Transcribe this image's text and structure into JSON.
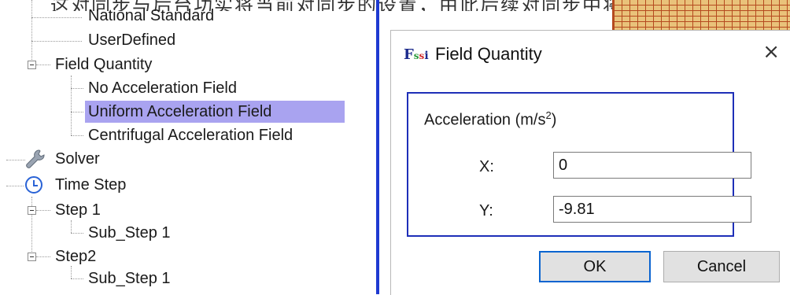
{
  "banner": {
    "text": "这对同步与后台功实将当前对同步的设置，由此后续对同步中将至更施加"
  },
  "tree": {
    "items": [
      {
        "label": "National Standard"
      },
      {
        "label": "UserDefined"
      },
      {
        "label": "Field Quantity"
      },
      {
        "label": "No Acceleration Field"
      },
      {
        "label": "Uniform Acceleration Field"
      },
      {
        "label": "Centrifugal Acceleration Field"
      },
      {
        "label": "Solver"
      },
      {
        "label": "Time Step"
      },
      {
        "label": "Step 1"
      },
      {
        "label": "Sub_Step 1"
      },
      {
        "label": "Step2"
      },
      {
        "label": "Sub_Step 1"
      }
    ]
  },
  "dialog": {
    "title": "Field Quantity",
    "close_glyph": "×",
    "group_label_prefix": "Acceleration (m/s",
    "group_label_sup": "2",
    "group_label_suffix": ")",
    "x_label": "X:",
    "x_value": "0",
    "y_label": "Y:",
    "y_value": "-9.81",
    "ok_label": "OK",
    "cancel_label": "Cancel"
  },
  "colors": {
    "selection": "#a9a3f0",
    "accent_blue": "#1e3ad1",
    "group_border": "#1e2fb8"
  }
}
